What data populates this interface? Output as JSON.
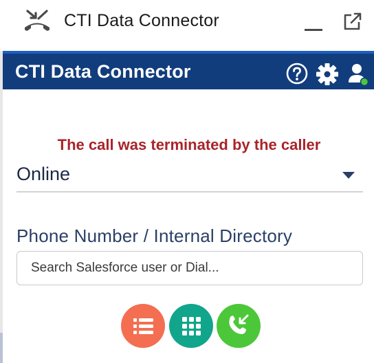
{
  "utility_bar": {
    "title": "CTI Data Connector",
    "icons": [
      "phone-hangup-icon",
      "minimize-icon",
      "popout-icon"
    ]
  },
  "header": {
    "title": "CTI Data Connector",
    "icons": [
      "help-icon",
      "gear-icon",
      "user-status-icon"
    ],
    "colors": {
      "background": "#123d7d",
      "accent_border": "#1e5fc0",
      "status_online": "#4cc739"
    }
  },
  "status_message": "The call was terminated by the caller",
  "status_select": {
    "value": "Online"
  },
  "phone_field": {
    "label": "Phone Number / Internal Directory",
    "placeholder": "Search Salesforce user or Dial..."
  },
  "actions": {
    "buttons": [
      {
        "name": "list",
        "icon": "list-icon",
        "color": "#f46e51"
      },
      {
        "name": "keypad",
        "icon": "keypad-icon",
        "color": "#11a58c"
      },
      {
        "name": "call",
        "icon": "phone-call-icon",
        "color": "#4cc739"
      }
    ]
  },
  "colors": {
    "error_text": "#a8242a",
    "label_text": "#2a3f66"
  }
}
